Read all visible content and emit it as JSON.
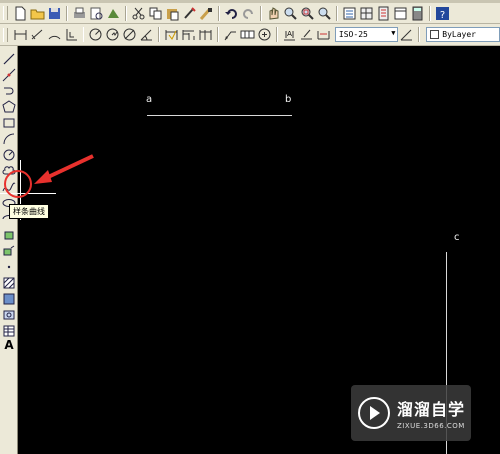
{
  "toolbar_top": {
    "icons": [
      "new-icon",
      "open-icon",
      "save-icon",
      "print-icon",
      "preview-icon",
      "publish-icon",
      "cut-icon",
      "copy-icon",
      "paste-icon",
      "match-properties-icon",
      "paint-icon",
      "undo-icon",
      "redo-icon",
      "pan-icon",
      "zoom-realtime-icon",
      "zoom-window-icon",
      "zoom-previous-icon",
      "properties-icon",
      "design-center-icon",
      "tool-palette-icon",
      "sheet-set-icon",
      "calculator-icon",
      "help-icon"
    ]
  },
  "toolbar_dim": {
    "dimstyle_value": "ISO-25",
    "layer_value": "ByLayer"
  },
  "left_toolbar": {
    "text_tool_label": "A"
  },
  "canvas": {
    "label_a": "a",
    "label_b": "b",
    "label_c": "c"
  },
  "tooltip": {
    "text": "样条曲线"
  },
  "watermark": {
    "title": "溜溜自学",
    "url": "ZIXUE.3D66.COM"
  },
  "colors": {
    "annotation_arrow": "#e8312d",
    "toolbar_bg": "#ece9d8",
    "canvas_bg": "#000000"
  }
}
